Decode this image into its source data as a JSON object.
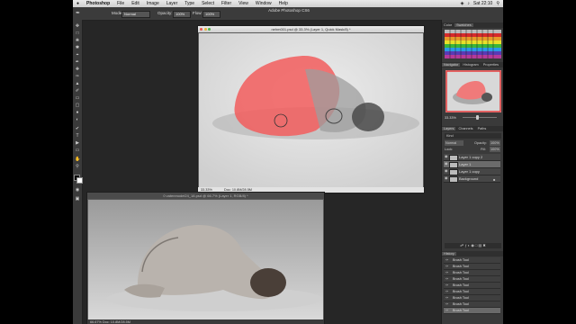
{
  "menu": {
    "apple": "",
    "app_name": "Photoshop",
    "items": [
      "File",
      "Edit",
      "Image",
      "Layer",
      "Type",
      "Select",
      "Filter",
      "View",
      "Window",
      "Help"
    ],
    "clock": "Sat 22:10"
  },
  "options": {
    "mode_label": "Mode:",
    "mode_value": "Normal",
    "opacity_label": "Opacity:",
    "opacity_value": "100%",
    "flow_label": "Flow:",
    "flow_value": "100%"
  },
  "app_title": "Adobe Photoshop CS6",
  "doc1": {
    "title": "nehm001.psd @ 33.3% (Layer 1, Quick Mask/8) *",
    "status_zoom": "33.33%",
    "status_doc": "Doc: 10.8M/28.5M"
  },
  "doc2": {
    "title": "0 vatenmodel24_18.psd @ 66.7% (Layer 1, RGB/8) *",
    "status": "66.67%  Doc: 10.8M/28.5M"
  },
  "panels": {
    "swatch_tabs": [
      "Color",
      "Swatches"
    ],
    "nav_tabs": [
      "Navigator",
      "Histogram",
      "Properties"
    ],
    "nav_zoom": "33.33%",
    "layer_tabs": [
      "Layers",
      "Channels",
      "Paths"
    ],
    "kind_label": "Kind",
    "blend": "Normal",
    "opacity_label": "Opacity:",
    "opacity_value": "100%",
    "lock_label": "Lock:",
    "fill_label": "Fill:",
    "fill_value": "100%",
    "layers": [
      {
        "name": "Layer 1 copy 2"
      },
      {
        "name": "Layer 1"
      },
      {
        "name": "Layer 1 copy"
      },
      {
        "name": "Background"
      }
    ],
    "history_tab": "History",
    "history": [
      "Brush Tool",
      "Brush Tool",
      "Brush Tool",
      "Brush Tool",
      "Brush Tool",
      "Brush Tool",
      "Brush Tool",
      "Brush Tool",
      "Brush Tool"
    ]
  }
}
